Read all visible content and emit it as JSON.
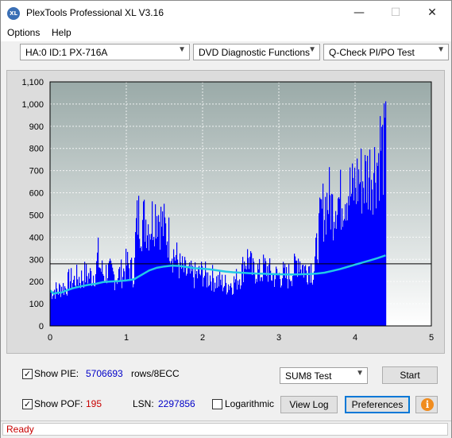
{
  "window": {
    "title": "PlexTools Professional XL V3.16",
    "icon_text": "XL",
    "minimize": "—",
    "maximize": "☐",
    "close": "✕"
  },
  "menu": {
    "items": [
      "Options",
      "Help"
    ]
  },
  "toolbar": {
    "drive": "HA:0 ID:1  PX-716A",
    "function": "DVD Diagnostic Functions",
    "test": "Q-Check PI/PO Test"
  },
  "chart_data": {
    "type": "bar",
    "xlim": [
      0,
      5
    ],
    "ylim": [
      0,
      1100
    ],
    "x_ticks": [
      "0",
      "1",
      "2",
      "3",
      "4",
      "5"
    ],
    "y_ticks": [
      "0",
      "100",
      "200",
      "300",
      "400",
      "500",
      "600",
      "700",
      "800",
      "900",
      "1,000",
      "1,100"
    ],
    "grid": true,
    "threshold": 280,
    "bar_color": "#0000ff",
    "line_color": "#22c8e6",
    "bar_envelope": [
      [
        0.0,
        195
      ],
      [
        0.05,
        210
      ],
      [
        0.1,
        205
      ],
      [
        0.15,
        230
      ],
      [
        0.2,
        220
      ],
      [
        0.25,
        270
      ],
      [
        0.3,
        260
      ],
      [
        0.35,
        280
      ],
      [
        0.4,
        275
      ],
      [
        0.45,
        300
      ],
      [
        0.5,
        290
      ],
      [
        0.55,
        295
      ],
      [
        0.6,
        320
      ],
      [
        0.62,
        420
      ],
      [
        0.65,
        340
      ],
      [
        0.7,
        300
      ],
      [
        0.75,
        320
      ],
      [
        0.8,
        300
      ],
      [
        0.85,
        285
      ],
      [
        0.9,
        300
      ],
      [
        0.95,
        310
      ],
      [
        1.0,
        360
      ],
      [
        1.05,
        330
      ],
      [
        1.1,
        300
      ],
      [
        1.12,
        560
      ],
      [
        1.15,
        640
      ],
      [
        1.2,
        600
      ],
      [
        1.25,
        620
      ],
      [
        1.3,
        580
      ],
      [
        1.35,
        640
      ],
      [
        1.4,
        680
      ],
      [
        1.45,
        600
      ],
      [
        1.5,
        560
      ],
      [
        1.55,
        520
      ],
      [
        1.6,
        430
      ],
      [
        1.65,
        400
      ],
      [
        1.7,
        340
      ],
      [
        1.75,
        320
      ],
      [
        1.8,
        300
      ],
      [
        1.9,
        290
      ],
      [
        2.0,
        310
      ],
      [
        2.05,
        280
      ],
      [
        2.1,
        290
      ],
      [
        2.15,
        270
      ],
      [
        2.2,
        260
      ],
      [
        2.3,
        240
      ],
      [
        2.4,
        250
      ],
      [
        2.5,
        300
      ],
      [
        2.55,
        380
      ],
      [
        2.6,
        400
      ],
      [
        2.65,
        310
      ],
      [
        2.7,
        330
      ],
      [
        2.75,
        300
      ],
      [
        2.8,
        340
      ],
      [
        2.85,
        330
      ],
      [
        2.9,
        290
      ],
      [
        3.0,
        290
      ],
      [
        3.05,
        300
      ],
      [
        3.1,
        280
      ],
      [
        3.2,
        330
      ],
      [
        3.25,
        400
      ],
      [
        3.3,
        350
      ],
      [
        3.35,
        320
      ],
      [
        3.4,
        360
      ],
      [
        3.45,
        300
      ],
      [
        3.5,
        480
      ],
      [
        3.55,
        640
      ],
      [
        3.6,
        700
      ],
      [
        3.65,
        740
      ],
      [
        3.7,
        680
      ],
      [
        3.75,
        760
      ],
      [
        3.8,
        720
      ],
      [
        3.85,
        780
      ],
      [
        3.9,
        800
      ],
      [
        3.95,
        760
      ],
      [
        4.0,
        820
      ],
      [
        4.05,
        860
      ],
      [
        4.1,
        840
      ],
      [
        4.15,
        870
      ],
      [
        4.2,
        900
      ],
      [
        4.25,
        920
      ],
      [
        4.3,
        970
      ],
      [
        4.33,
        1070
      ],
      [
        4.36,
        1000
      ],
      [
        4.4,
        1050
      ]
    ],
    "pif_line": [
      [
        0.0,
        160
      ],
      [
        0.05,
        145
      ],
      [
        0.1,
        150
      ],
      [
        0.15,
        150
      ],
      [
        0.2,
        158
      ],
      [
        0.3,
        170
      ],
      [
        0.4,
        178
      ],
      [
        0.5,
        185
      ],
      [
        0.6,
        190
      ],
      [
        0.7,
        198
      ],
      [
        0.8,
        200
      ],
      [
        0.9,
        202
      ],
      [
        1.0,
        205
      ],
      [
        1.1,
        210
      ],
      [
        1.2,
        230
      ],
      [
        1.3,
        250
      ],
      [
        1.4,
        262
      ],
      [
        1.5,
        268
      ],
      [
        1.6,
        272
      ],
      [
        1.7,
        270
      ],
      [
        1.8,
        265
      ],
      [
        1.9,
        260
      ],
      [
        2.0,
        258
      ],
      [
        2.1,
        255
      ],
      [
        2.2,
        250
      ],
      [
        2.3,
        245
      ],
      [
        2.4,
        242
      ],
      [
        2.5,
        240
      ],
      [
        2.6,
        238
      ],
      [
        2.7,
        236
      ],
      [
        2.8,
        235
      ],
      [
        2.9,
        234
      ],
      [
        3.0,
        233
      ],
      [
        3.1,
        232
      ],
      [
        3.2,
        232
      ],
      [
        3.3,
        233
      ],
      [
        3.4,
        234
      ],
      [
        3.5,
        236
      ],
      [
        3.6,
        240
      ],
      [
        3.7,
        248
      ],
      [
        3.8,
        256
      ],
      [
        3.9,
        266
      ],
      [
        4.0,
        276
      ],
      [
        4.1,
        286
      ],
      [
        4.2,
        296
      ],
      [
        4.3,
        306
      ],
      [
        4.4,
        318
      ]
    ]
  },
  "bottom": {
    "show_pie_label": "Show PIE:",
    "pie_value": "5706693",
    "pie_unit": "rows/8ECC",
    "show_pof_label": "Show POF:",
    "pof_value": "195",
    "lsn_label": "LSN:",
    "lsn_value": "2297856",
    "log_label": "Logarithmic",
    "test_select": "SUM8 Test",
    "start": "Start",
    "view_log": "View Log",
    "preferences": "Preferences",
    "info": "i",
    "pie_checked": "✓",
    "pof_checked": "✓"
  },
  "status": {
    "text": "Ready"
  }
}
